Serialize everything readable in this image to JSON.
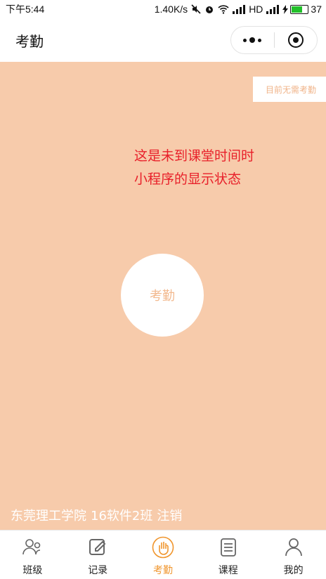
{
  "statusbar": {
    "time": "下午5:44",
    "network_speed": "1.40K/s",
    "signal_text": "HD",
    "battery": "37"
  },
  "navbar": {
    "title": "考勤",
    "menu_icon": "more-dots-icon",
    "close_icon": "target-circle-icon"
  },
  "main": {
    "status_tag": "目前无需考勤",
    "annotation_line1": "这是未到课堂时间时",
    "annotation_line2": "小程序的显示状态",
    "checkin_button": "考勤",
    "footer": {
      "school": "东莞理工学院",
      "class": "16软件2班",
      "logout": "注销"
    }
  },
  "tabs": [
    {
      "label": "班级",
      "icon": "users-icon",
      "active": false
    },
    {
      "label": "记录",
      "icon": "edit-icon",
      "active": false
    },
    {
      "label": "考勤",
      "icon": "hand-icon",
      "active": true
    },
    {
      "label": "课程",
      "icon": "list-icon",
      "active": false
    },
    {
      "label": "我的",
      "icon": "user-icon",
      "active": false
    }
  ],
  "colors": {
    "background": "#f7cbab",
    "accent": "#f0962e",
    "annotation": "#e8202a"
  }
}
